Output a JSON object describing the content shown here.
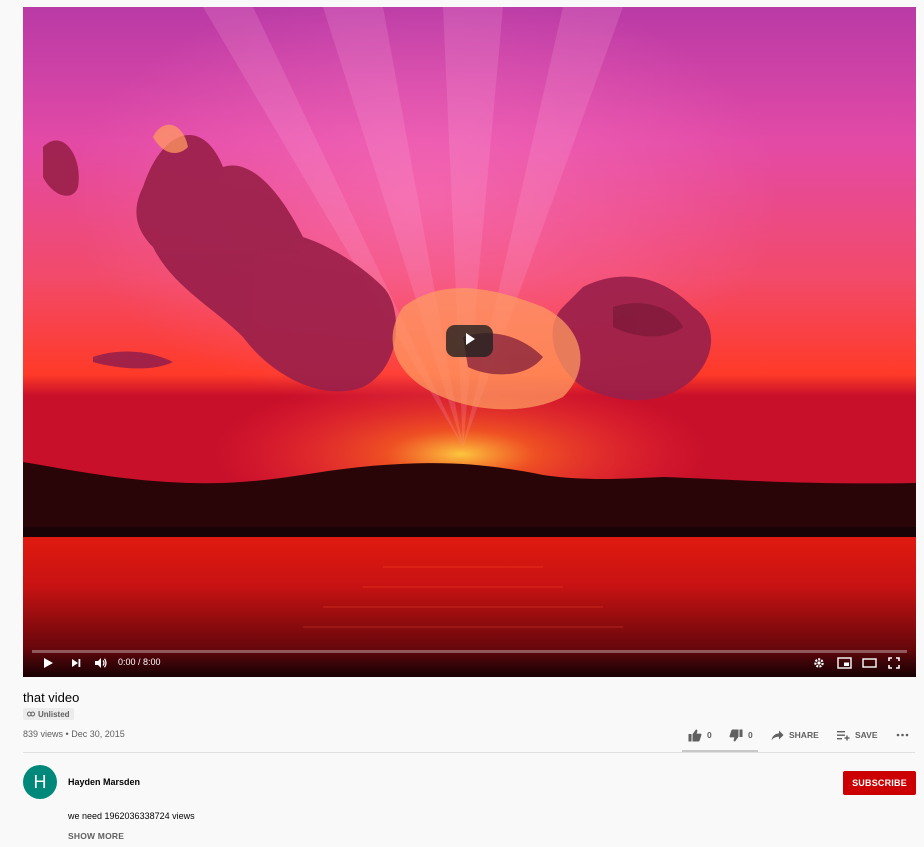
{
  "player": {
    "time_display": "0:00 / 8:00",
    "progress": 0
  },
  "video": {
    "title": "that video",
    "visibility": "Unlisted",
    "views": "839 views",
    "separator": "•",
    "date": "Dec 30, 2015"
  },
  "actions": {
    "likes": "0",
    "dislikes": "0",
    "share_label": "SHARE",
    "save_label": "SAVE"
  },
  "channel": {
    "avatar_letter": "H",
    "name": "Hayden Marsden",
    "subscribe_label": "SUBSCRIBE"
  },
  "description": {
    "text": "we need 1962036338724 views",
    "show_more_label": "SHOW MORE"
  },
  "colors": {
    "subscribe": "#cc0000",
    "avatar": "#00897b",
    "background": "#f9f9f9"
  },
  "icons": [
    "play-icon",
    "next-icon",
    "volume-icon",
    "settings-icon",
    "miniplayer-icon",
    "theater-icon",
    "fullscreen-icon",
    "like-icon",
    "dislike-icon",
    "share-icon",
    "save-playlist-icon",
    "more-icon",
    "link-icon"
  ]
}
